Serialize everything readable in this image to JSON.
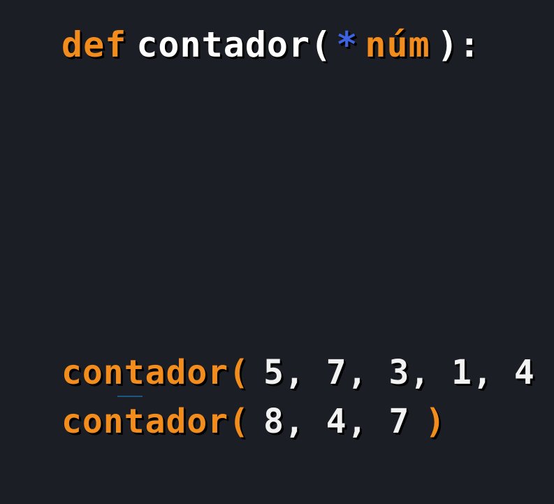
{
  "code": {
    "def_line": {
      "keyword": "def",
      "function_name": "contador(",
      "star": "*",
      "parameter": "núm",
      "closing": "):"
    },
    "call_1": {
      "function_name": "contador(",
      "arguments": "5, 7, 3, 1, 4",
      "closing": ")"
    },
    "call_2": {
      "function_name": "contador(",
      "arguments": "8, 4, 7",
      "closing": ")"
    }
  },
  "colors": {
    "background": "#1c1e26",
    "keyword": "#f28c1c",
    "identifier": "#ffffff",
    "operator": "#3d63e0"
  }
}
